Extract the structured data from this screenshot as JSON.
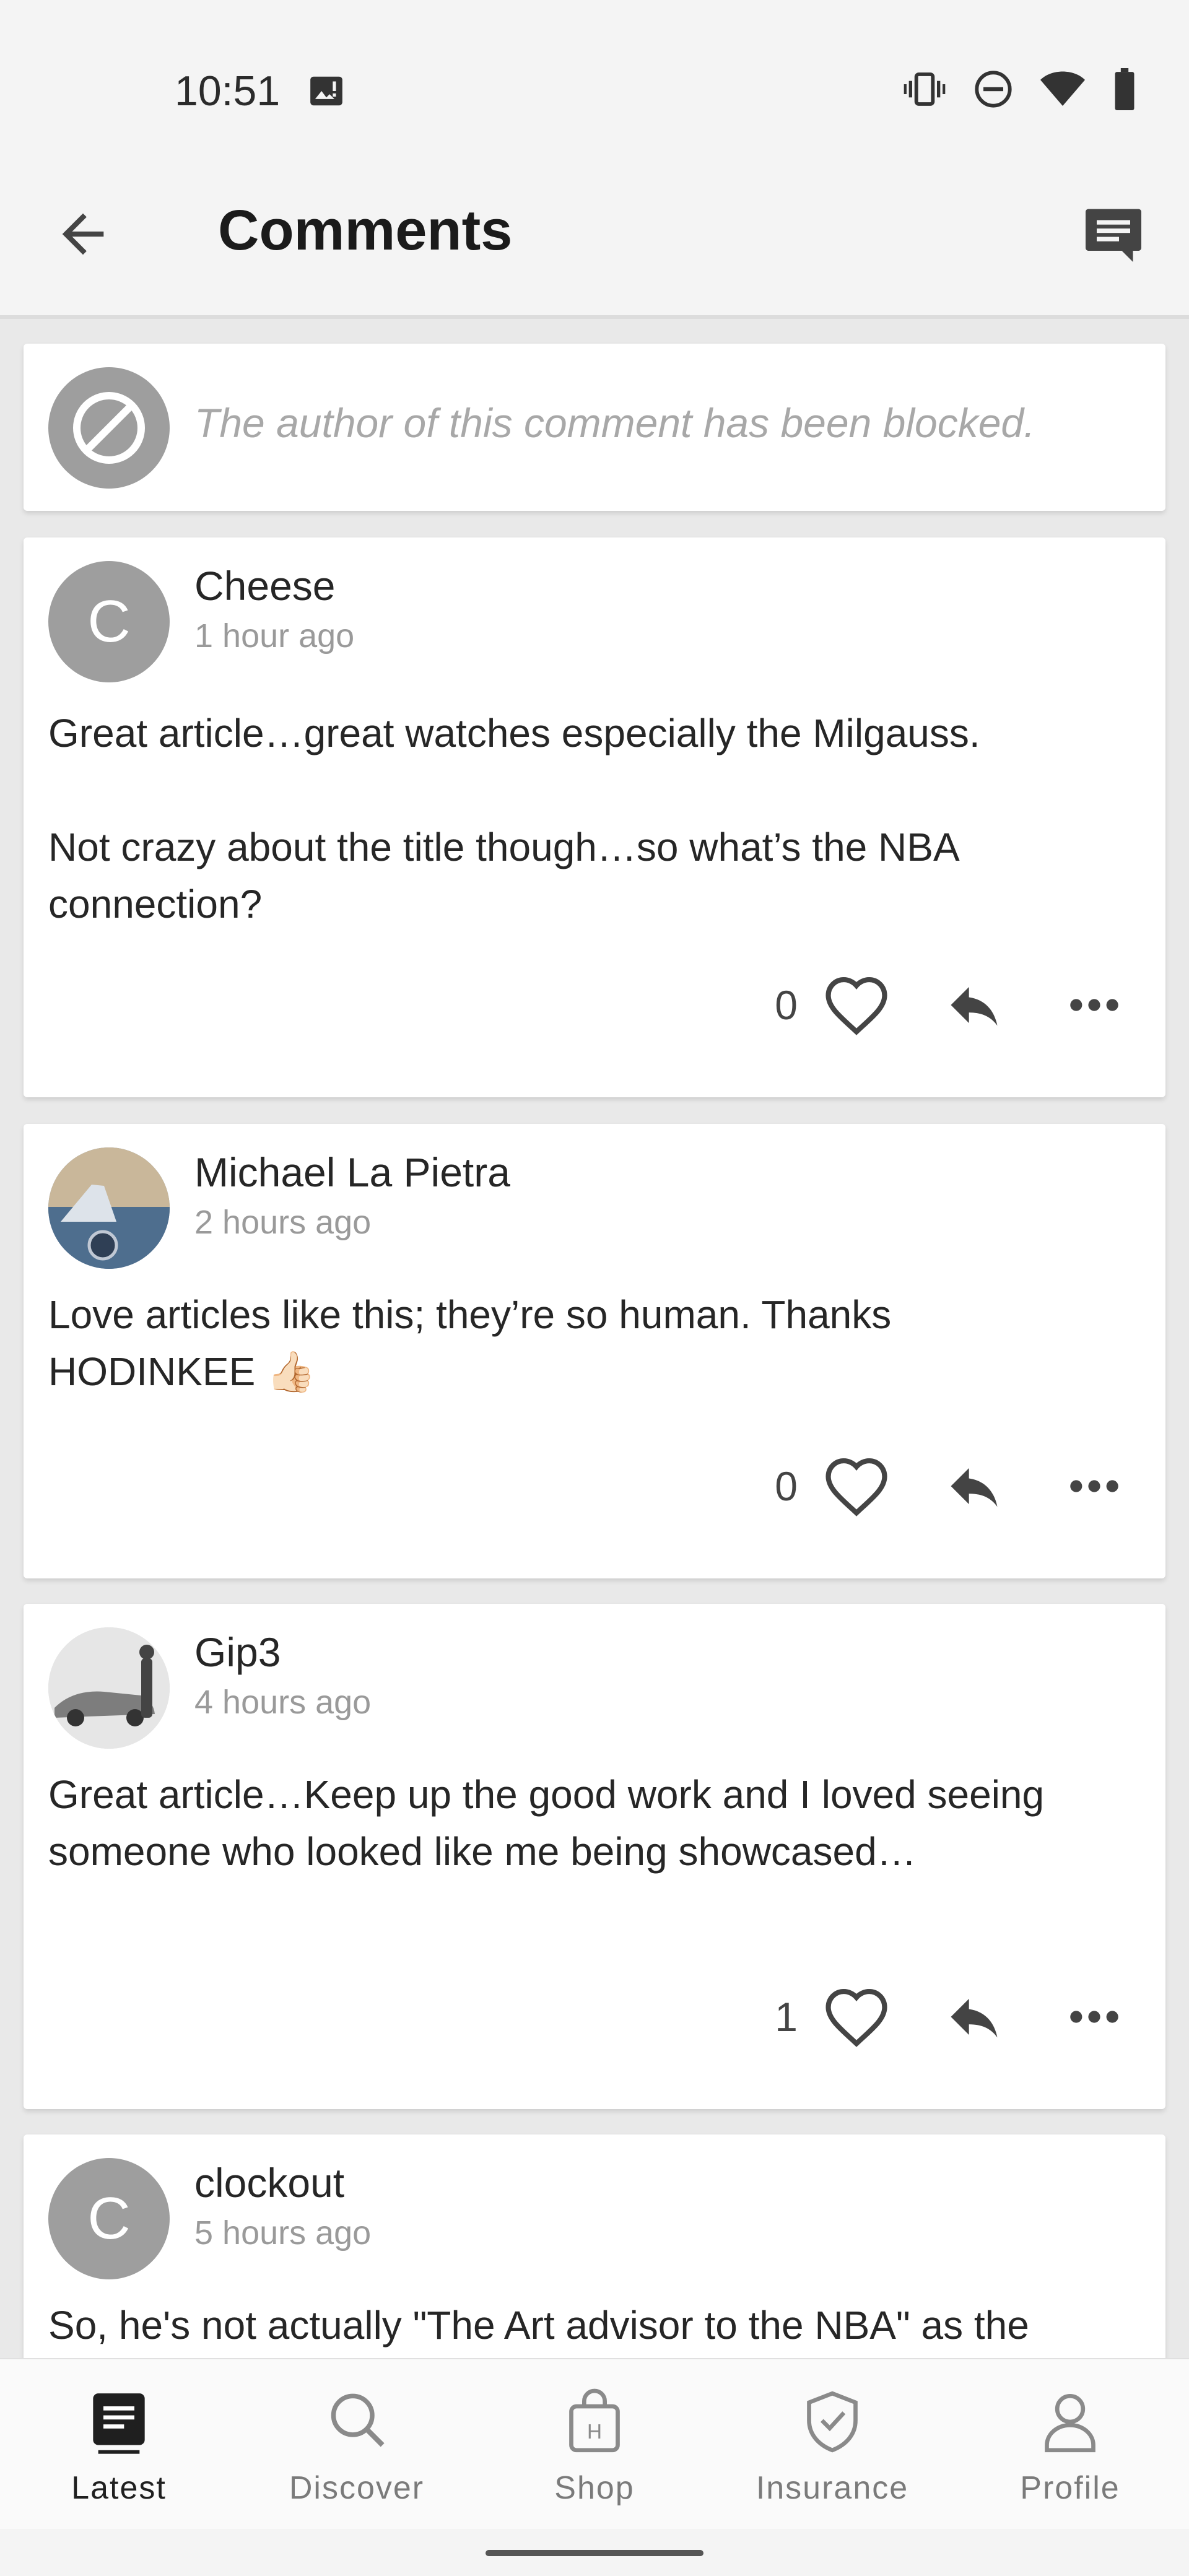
{
  "status_bar": {
    "time": "10:51",
    "icons": [
      "image-notification-icon",
      "vibrate-icon",
      "do-not-disturb-icon",
      "wifi-icon",
      "battery-icon"
    ]
  },
  "app_bar": {
    "title": "Comments",
    "back_icon": "arrow-left-icon",
    "action_icon": "comments-icon"
  },
  "blocked_notice": "The author of this comment has been blocked.",
  "comments": [
    {
      "author": "Cheese",
      "initial": "C",
      "time": "1 hour ago",
      "paragraphs": [
        "Great article…great watches especially the Milgauss.",
        "Not crazy about the title though…so what’s the NBA connection?"
      ],
      "likes": "0"
    },
    {
      "author": "Michael La Pietra",
      "time": "2 hours ago",
      "paragraphs": [
        "Love articles like this; they’re so human. Thanks HODINKEE 👍🏻"
      ],
      "likes": "0"
    },
    {
      "author": "Gip3",
      "time": "4 hours ago",
      "paragraphs": [
        "Great article…Keep up the good work and I loved seeing someone who looked like me being showcased…"
      ],
      "likes": "1"
    },
    {
      "author": "clockout",
      "initial": "C",
      "time": "5 hours ago",
      "paragraphs": [
        "So, he's not actually \"The Art advisor to the NBA\" as the"
      ]
    }
  ],
  "bottom_nav": {
    "active": "Latest",
    "items": [
      {
        "label": "Latest",
        "icon": "article-icon"
      },
      {
        "label": "Discover",
        "icon": "search-icon"
      },
      {
        "label": "Shop",
        "icon": "shopping-bag-icon"
      },
      {
        "label": "Insurance",
        "icon": "shield-check-icon"
      },
      {
        "label": "Profile",
        "icon": "person-icon"
      }
    ]
  },
  "colors": {
    "avatar_gray": "#9e9e9e",
    "text_dark": "#262626",
    "text_muted": "#9a9a9a",
    "background": "#e9e9e9"
  }
}
